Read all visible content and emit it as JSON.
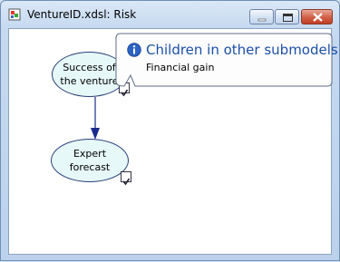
{
  "window": {
    "title": "VentureID.xdsl: Risk",
    "buttons": {
      "minimize": "minimize",
      "maximize": "maximize",
      "close": "close"
    }
  },
  "nodes": [
    {
      "label_line1": "Success of",
      "label_line2": "the venture"
    },
    {
      "label": "Expert forecast"
    }
  ],
  "callout": {
    "title": "Children in other submodels",
    "subtitle": "Financial gain"
  },
  "colors": {
    "node_fill": "#e6f8f8",
    "node_border": "#2a3f7a",
    "arrow": "#1a2a8c",
    "callout_title": "#1b4fa8"
  }
}
